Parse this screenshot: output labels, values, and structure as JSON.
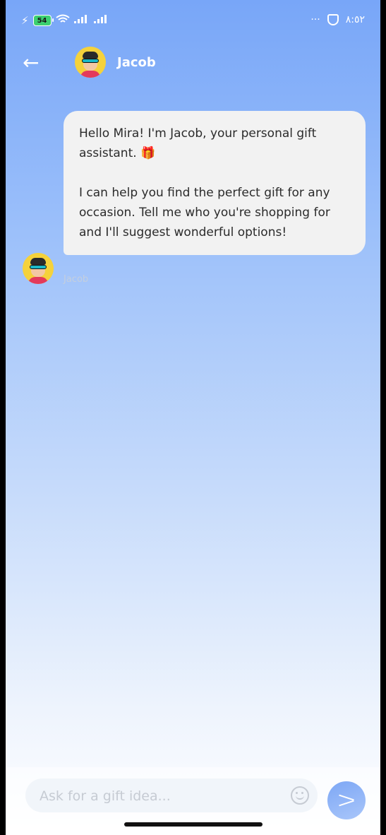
{
  "status_bar": {
    "battery_level": "54",
    "more_dots": "···",
    "time": "٨:٥٢"
  },
  "header": {
    "back_icon": "←",
    "title": "Jacob"
  },
  "messages": [
    {
      "sender": "Jacob",
      "paragraphs": [
        "Hello Mira! I'm Jacob, your personal gift assistant. 🎁",
        "I can help you find the perfect gift for any occasion. Tell me who you're shopping for and I'll suggest wonderful options!"
      ]
    }
  ],
  "input": {
    "placeholder": "Ask for a gift idea..."
  },
  "colors": {
    "gradient_top": "#78a6f8",
    "bubble_bg": "#f2f2f2",
    "avatar_bg": "#f5d23b"
  }
}
